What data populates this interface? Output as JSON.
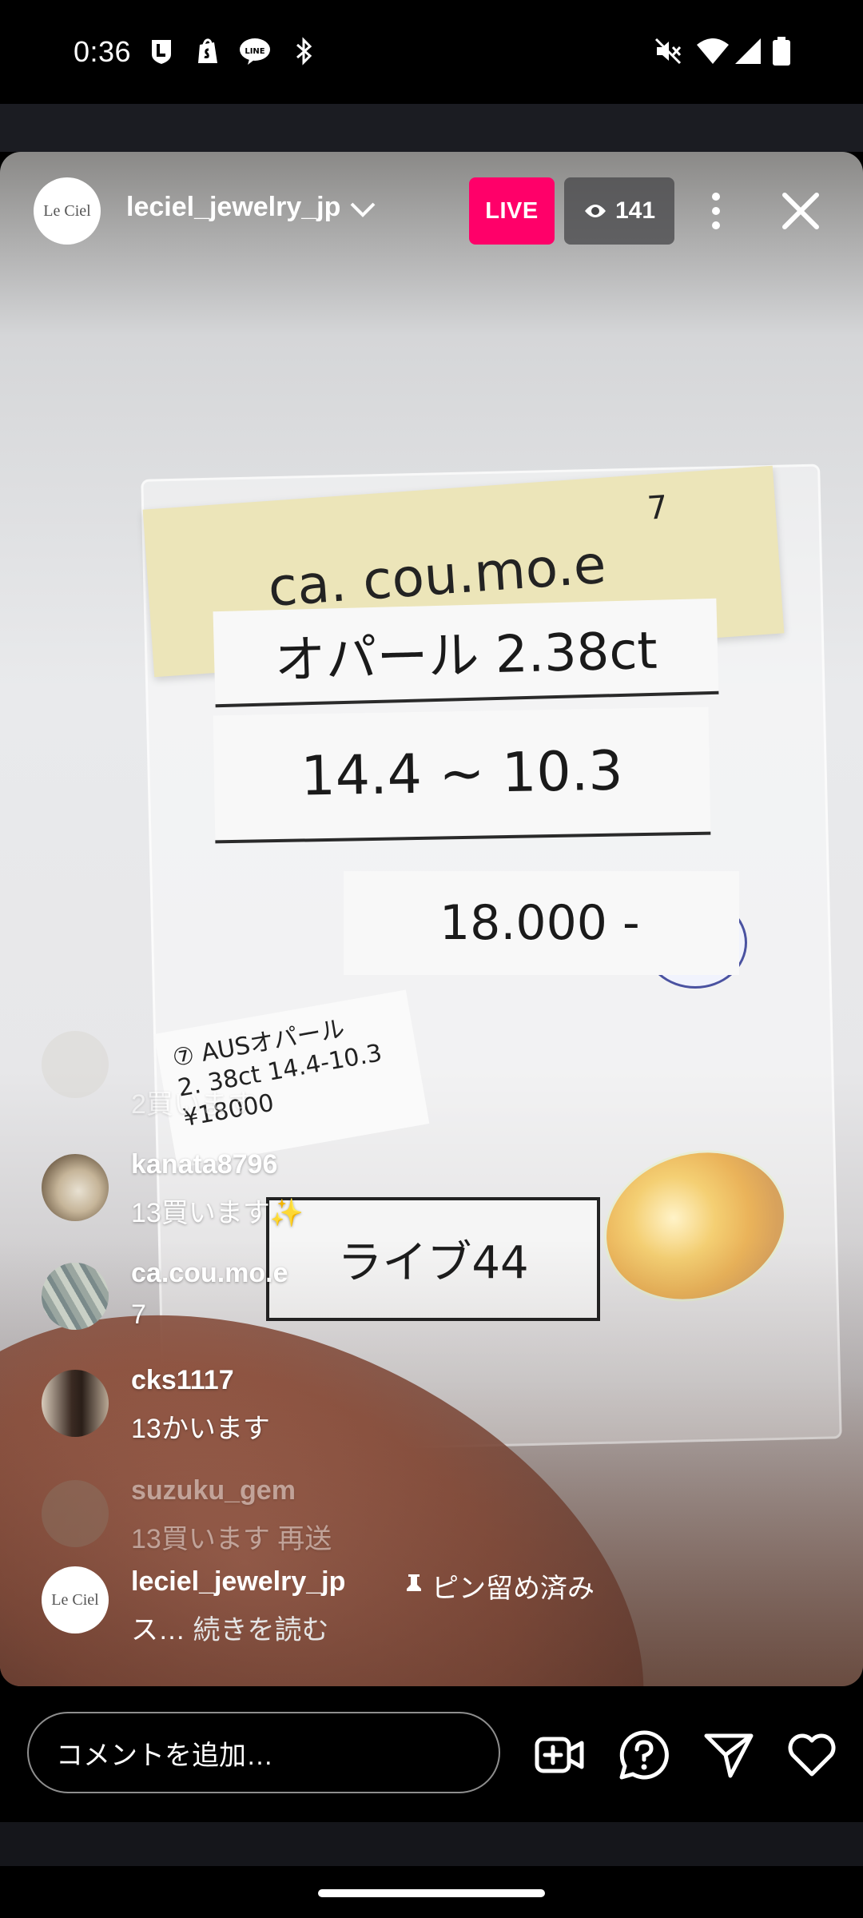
{
  "status_bar": {
    "time": "0:36",
    "icons": [
      "l-app-icon",
      "shopify-icon",
      "line-icon",
      "bluetooth-icon",
      "mute-icon",
      "wifi-icon",
      "signal-icon",
      "battery-icon"
    ]
  },
  "header": {
    "host_logo": "Le Ciel",
    "host_username": "leciel_jewelry_jp",
    "live_label": "LIVE",
    "viewer_count": "141"
  },
  "video_scene": {
    "sticky_note": "ca. cou.mo.e",
    "sticky_note_number": "7",
    "card_line1": "オパール 2.38ct",
    "card_line2": "14.4 ~ 10.3",
    "price_card": "18.000 -",
    "small_label": [
      "⑦ AUSオパール",
      "2. 38ct 14.4-10.3",
      "¥18000"
    ],
    "live_card": "ライブ44"
  },
  "comments": [
    {
      "user": "",
      "text": "2買います",
      "faded": true
    },
    {
      "user": "kanata8796",
      "text": "13買います✨"
    },
    {
      "user": "ca.cou.mo.e",
      "text": "7"
    },
    {
      "user": "cks1117",
      "text": "13かいます"
    },
    {
      "user": "suzuku_gem",
      "text": "13買います 再送",
      "faded": true
    }
  ],
  "pinned_comment": {
    "user": "leciel_jewelry_jp",
    "pinned_label": "ピン留め済み",
    "text_prefix": "ス…",
    "read_more": "続きを読む"
  },
  "composer": {
    "placeholder": "コメントを追加…",
    "icons": [
      "add-video-icon",
      "question-icon",
      "send-icon",
      "heart-icon"
    ]
  },
  "colors": {
    "live_badge": "#ff0069",
    "background": "#000000"
  }
}
